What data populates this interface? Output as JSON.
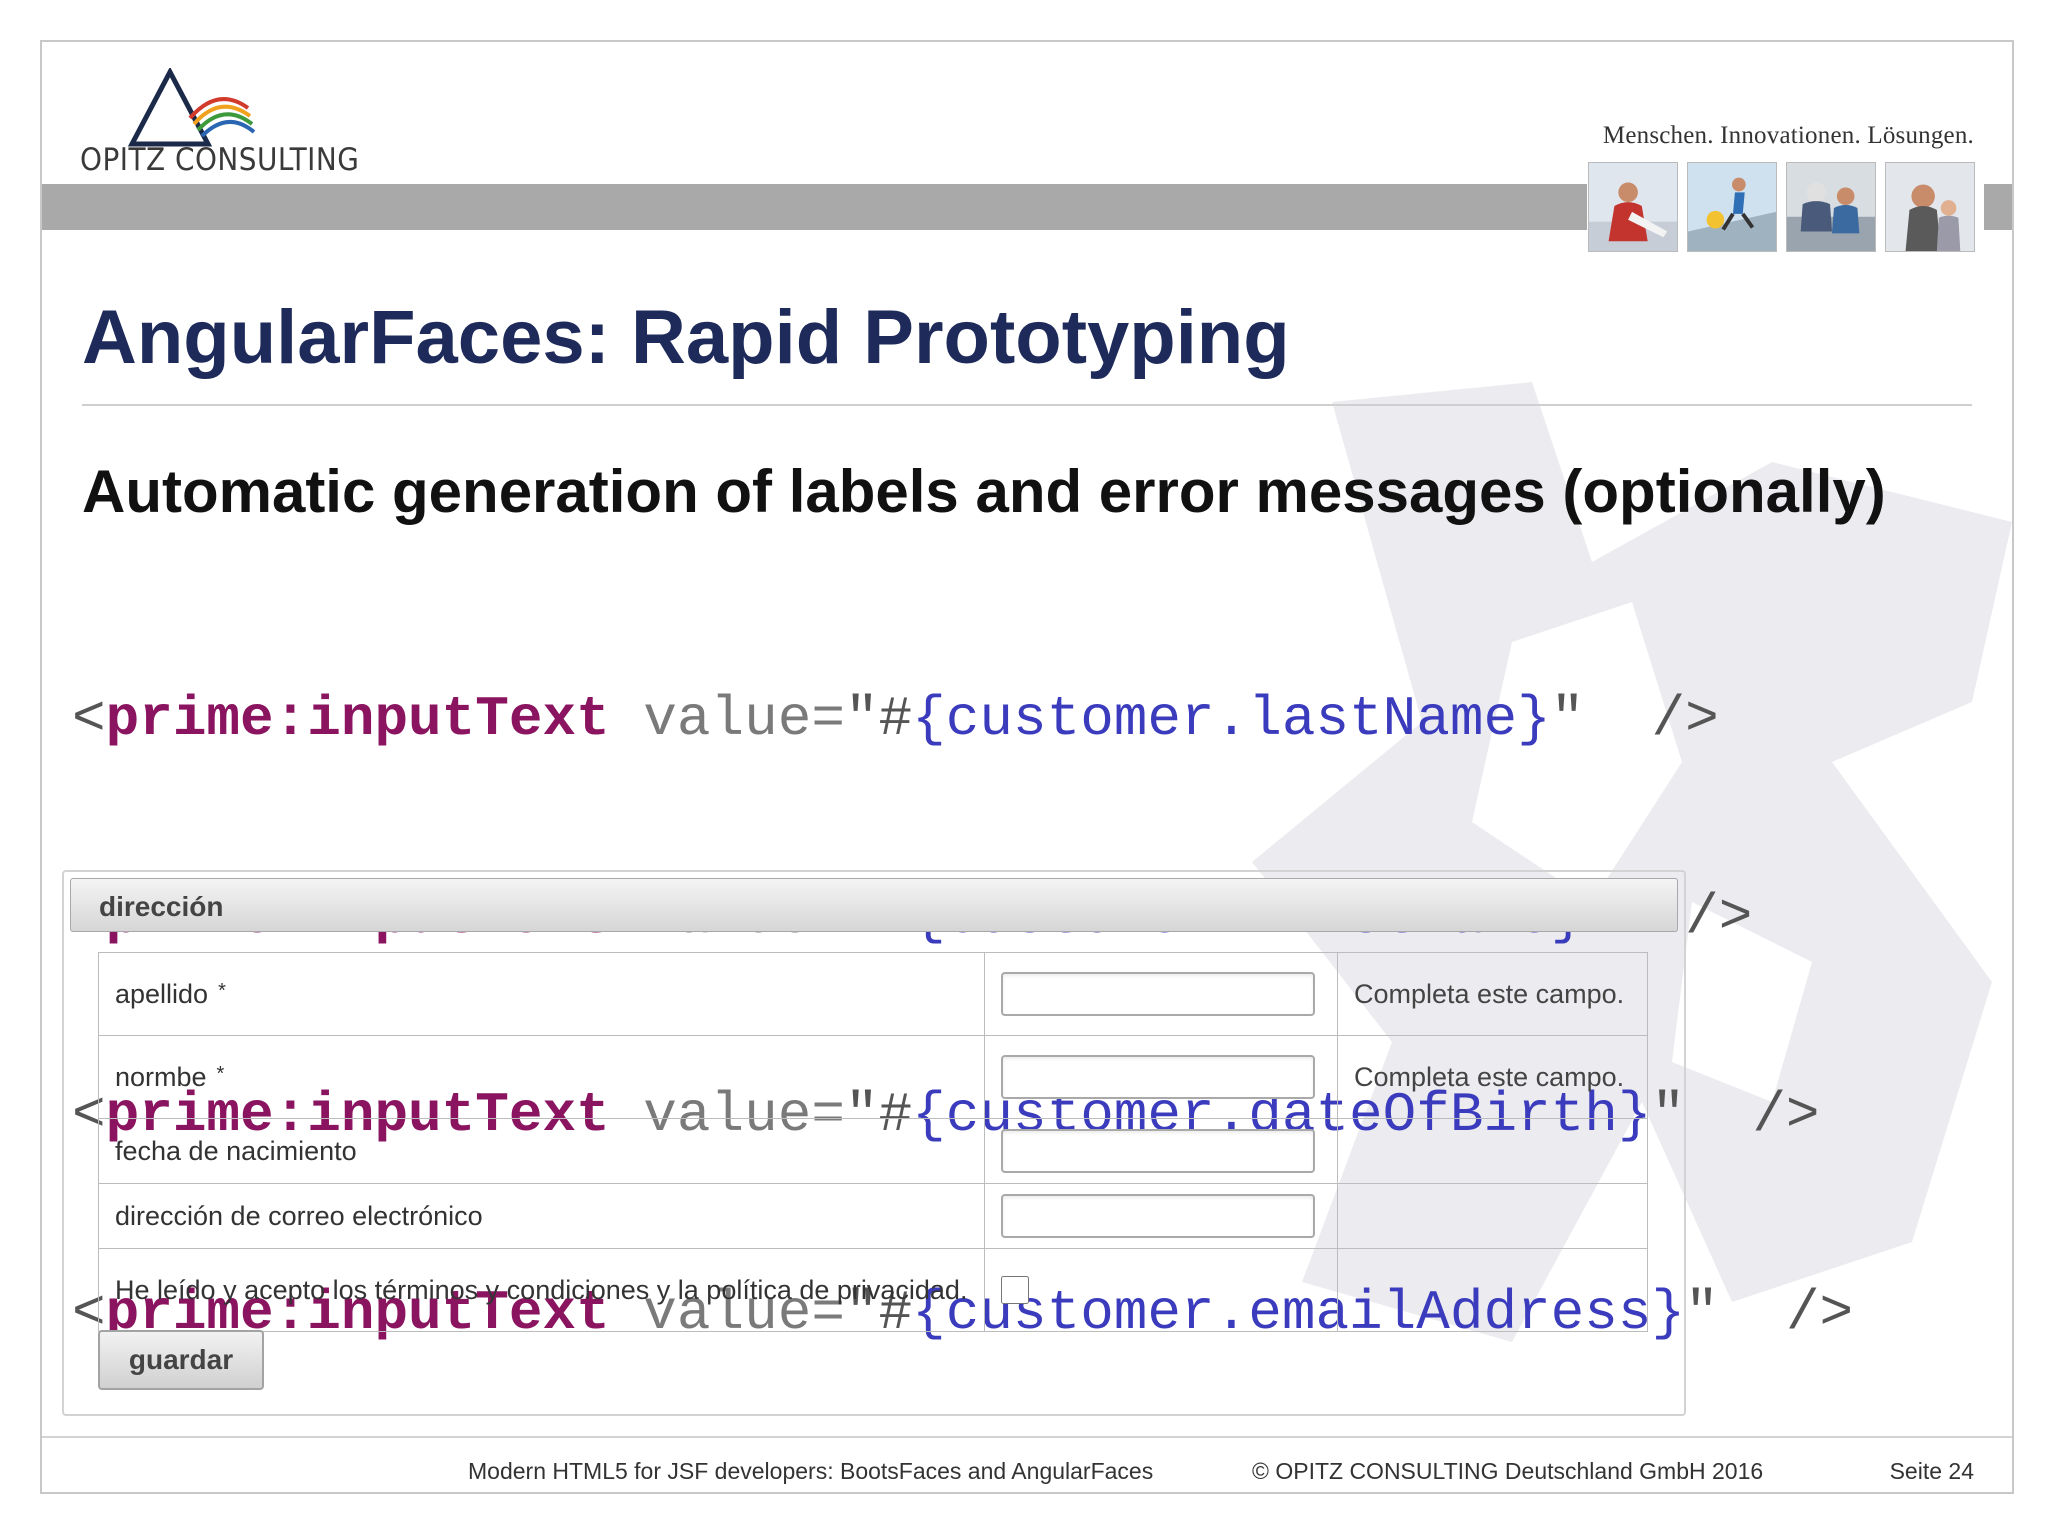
{
  "header": {
    "logo_text": "OPITZ CONSULTING",
    "slogan": "Menschen. Innovationen. Lösungen.",
    "photos": [
      "photo-woman-icon",
      "photo-runner-icon",
      "photo-couple-icon",
      "photo-family-icon"
    ]
  },
  "slide": {
    "title": "AngularFaces: Rapid Prototyping",
    "subtitle": "Automatic generation of labels and error messages (optionally)"
  },
  "code": {
    "lines": [
      {
        "open": "<",
        "tag": "prime:inputText",
        "attr": " value=",
        "q1": "\"",
        "hash": "#",
        "expr": "{customer.lastName}",
        "q2": "\"",
        "gap": "  ",
        "close": "/>"
      },
      {
        "open": "<",
        "tag": "prime:inputText",
        "attr": " value=",
        "q1": "\"",
        "hash": "#",
        "expr": "{customer.firstName}",
        "q2": "\"",
        "gap": "  ",
        "close": "/>"
      },
      {
        "open": "<",
        "tag": "prime:inputText",
        "attr": " value=",
        "q1": "\"",
        "hash": "#",
        "expr": "{customer.dateOfBirth}",
        "q2": "\"",
        "gap": "  ",
        "close": "/>"
      },
      {
        "open": "<",
        "tag": "prime:inputText",
        "attr": " value=",
        "q1": "\"",
        "hash": "#",
        "expr": "{customer.emailAddress}",
        "q2": "\"",
        "gap": "  ",
        "close": "/>"
      }
    ]
  },
  "form": {
    "title": "dirección",
    "rows": [
      {
        "label": "apellido",
        "required": "*",
        "type": "text",
        "message": "Completa este campo."
      },
      {
        "label": "normbe",
        "required": "*",
        "type": "text",
        "message": "Completa este campo."
      },
      {
        "label": "fecha de nacimiento",
        "required": "",
        "type": "text",
        "message": ""
      },
      {
        "label": "dirección de correo electrónico",
        "required": "",
        "type": "text",
        "message": ""
      },
      {
        "label": "He leído y acepto los términos y condiciones y la política de privacidad.",
        "required": "",
        "type": "checkbox",
        "message": ""
      }
    ],
    "save_label": "guardar"
  },
  "footer": {
    "left": "Modern HTML5 for JSF developers: BootsFaces and AngularFaces",
    "middle": "© OPITZ CONSULTING Deutschland GmbH 2016",
    "right": "Seite 24"
  },
  "colors": {
    "title": "#1e2a5a",
    "code_tag": "#8b1460",
    "code_expr": "#3b3bbd",
    "header_bar": "#a9a9a9"
  }
}
